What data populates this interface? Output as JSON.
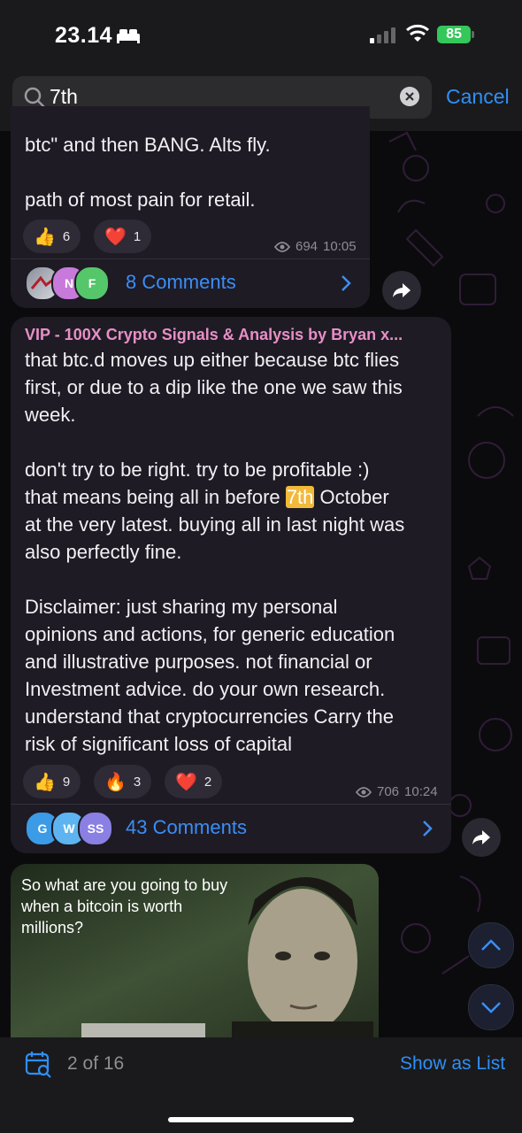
{
  "status": {
    "time": "23.14",
    "battery": "85"
  },
  "search": {
    "query": "7th",
    "cancel": "Cancel"
  },
  "messages": [
    {
      "lines": [
        "btc\" and then BANG. Alts fly.",
        "",
        "path of most pain for retail."
      ],
      "reactions": [
        {
          "emoji": "👍",
          "count": "6"
        },
        {
          "emoji": "❤️",
          "count": "1"
        }
      ],
      "views": "694",
      "time": "10:05",
      "avatars": [
        "",
        "N",
        "F"
      ],
      "comments": "8 Comments"
    },
    {
      "sender": "VIP - 100X Crypto Signals & Analysis by Bryan x...",
      "text_before": "that btc.d moves up either because btc flies\nfirst, or due to a dip like the one we saw this\nweek.\n\ndon't try to be right. try to be profitable :)\nthat means being all in before ",
      "text_highlight": "7th",
      "text_after": " October\nat the very latest. buying all in last night was\nalso perfectly fine.\n\nDisclaimer: just sharing my personal\nopinions and actions, for generic education\nand illustrative purposes. not financial or\nInvestment advice. do your own research.\nunderstand that cryptocurrencies Carry the\nrisk of significant loss of capital",
      "reactions": [
        {
          "emoji": "👍",
          "count": "9"
        },
        {
          "emoji": "🔥",
          "count": "3"
        },
        {
          "emoji": "❤️",
          "count": "2"
        }
      ],
      "views": "706",
      "time": "10:24",
      "avatars": [
        "G",
        "W",
        "SS"
      ],
      "comments": "43 Comments"
    },
    {
      "caption": "So what are you going to buy when a bitcoin is worth millions?"
    }
  ],
  "bottom": {
    "counter": "2 of 16",
    "show_list": "Show as List"
  },
  "colors": {
    "accent": "#2f8ff5",
    "highlight": "#f2b93a",
    "sender": "#e78fc5"
  }
}
